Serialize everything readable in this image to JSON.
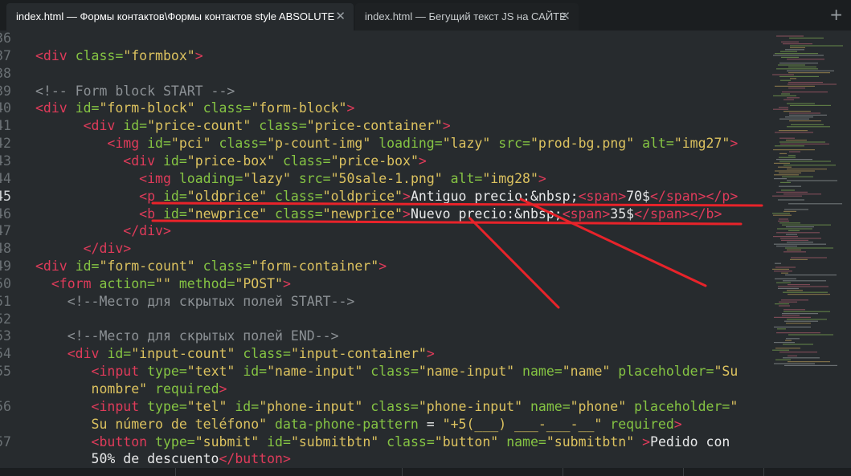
{
  "tabs": [
    {
      "label": "index.html — Формы контактов\\Формы контактов style ABSOLUTE",
      "active": true
    },
    {
      "label": "index.html — Бегущий текст JS на САЙТЕ",
      "active": false
    }
  ],
  "close_glyph": "✕",
  "new_tab_glyph": "+",
  "active_line": "45",
  "colors": {
    "tag": "#df3b5a",
    "attribute": "#85c443",
    "string": "#dcc25f",
    "text": "#e7e8e9",
    "comment": "#8c9195",
    "annotation": "#e8232a",
    "background": "#272b2e"
  },
  "lines": [
    {
      "n": "36",
      "tokens": []
    },
    {
      "n": "37",
      "tokens": [
        [
          "tag",
          "<div"
        ],
        [
          "txt",
          " "
        ],
        [
          "attr",
          "class="
        ],
        [
          "val",
          "\"formbox\""
        ],
        [
          "tag",
          ">"
        ]
      ]
    },
    {
      "n": "38",
      "tokens": []
    },
    {
      "n": "39",
      "tokens": [
        [
          "com",
          "<!-- Form block START -->"
        ]
      ]
    },
    {
      "n": "40",
      "tokens": [
        [
          "tag",
          "<div"
        ],
        [
          "txt",
          " "
        ],
        [
          "attr",
          "id="
        ],
        [
          "val",
          "\"form-block\""
        ],
        [
          "txt",
          " "
        ],
        [
          "attr",
          "class="
        ],
        [
          "val",
          "\"form-block\""
        ],
        [
          "tag",
          ">"
        ]
      ]
    },
    {
      "n": "41",
      "tokens": [
        [
          "txt",
          "      "
        ],
        [
          "tag",
          "<div"
        ],
        [
          "txt",
          " "
        ],
        [
          "attr",
          "id="
        ],
        [
          "val",
          "\"price-count\""
        ],
        [
          "txt",
          " "
        ],
        [
          "attr",
          "class="
        ],
        [
          "val",
          "\"price-container\""
        ],
        [
          "tag",
          ">"
        ]
      ]
    },
    {
      "n": "42",
      "tokens": [
        [
          "txt",
          "         "
        ],
        [
          "tag",
          "<img"
        ],
        [
          "txt",
          " "
        ],
        [
          "attr",
          "id="
        ],
        [
          "val",
          "\"pci\""
        ],
        [
          "txt",
          " "
        ],
        [
          "attr",
          "class="
        ],
        [
          "val",
          "\"p-count-img\""
        ],
        [
          "txt",
          " "
        ],
        [
          "attr",
          "loading="
        ],
        [
          "val",
          "\"lazy\""
        ],
        [
          "txt",
          " "
        ],
        [
          "attr",
          "src="
        ],
        [
          "val",
          "\"prod-bg.png\""
        ],
        [
          "txt",
          " "
        ],
        [
          "attr",
          "alt="
        ],
        [
          "val",
          "\"img27\""
        ],
        [
          "tag",
          ">"
        ]
      ]
    },
    {
      "n": "43",
      "tokens": [
        [
          "txt",
          "           "
        ],
        [
          "tag",
          "<div"
        ],
        [
          "txt",
          " "
        ],
        [
          "attr",
          "id="
        ],
        [
          "val",
          "\"price-box\""
        ],
        [
          "txt",
          " "
        ],
        [
          "attr",
          "class="
        ],
        [
          "val",
          "\"price-box\""
        ],
        [
          "tag",
          ">"
        ]
      ]
    },
    {
      "n": "44",
      "tokens": [
        [
          "txt",
          "             "
        ],
        [
          "tag",
          "<img"
        ],
        [
          "txt",
          " "
        ],
        [
          "attr",
          "loading="
        ],
        [
          "val",
          "\"lazy\""
        ],
        [
          "txt",
          " "
        ],
        [
          "attr",
          "src="
        ],
        [
          "val",
          "\"50sale-1.png\""
        ],
        [
          "txt",
          " "
        ],
        [
          "attr",
          "alt="
        ],
        [
          "val",
          "\"img28\""
        ],
        [
          "tag",
          ">"
        ]
      ]
    },
    {
      "n": "45",
      "tokens": [
        [
          "txt",
          "             "
        ],
        [
          "tag",
          "<p"
        ],
        [
          "txt",
          " "
        ],
        [
          "attr",
          "id="
        ],
        [
          "val",
          "\"oldprice\""
        ],
        [
          "txt",
          " "
        ],
        [
          "attr",
          "class="
        ],
        [
          "val",
          "\"oldprice\""
        ],
        [
          "tag",
          ">"
        ],
        [
          "txt",
          "Antiguo precio:&nbsp;"
        ],
        [
          "tag",
          "<span>"
        ],
        [
          "txt",
          "70$"
        ],
        [
          "tag",
          "</span></p>"
        ]
      ]
    },
    {
      "n": "46",
      "tokens": [
        [
          "txt",
          "             "
        ],
        [
          "tag",
          "<b"
        ],
        [
          "txt",
          " "
        ],
        [
          "attr",
          "id="
        ],
        [
          "val",
          "\"newprice\""
        ],
        [
          "txt",
          " "
        ],
        [
          "attr",
          "class="
        ],
        [
          "val",
          "\"newprice\""
        ],
        [
          "tag",
          ">"
        ],
        [
          "txt",
          "Nuevo precio:&nbsp;"
        ],
        [
          "tag",
          "<span>"
        ],
        [
          "txt",
          "35$"
        ],
        [
          "tag",
          "</span></b>"
        ]
      ]
    },
    {
      "n": "47",
      "tokens": [
        [
          "txt",
          "           "
        ],
        [
          "tag",
          "</div>"
        ]
      ]
    },
    {
      "n": "48",
      "tokens": [
        [
          "txt",
          "      "
        ],
        [
          "tag",
          "</div>"
        ]
      ]
    },
    {
      "n": "49",
      "tokens": [
        [
          "tag",
          "<div"
        ],
        [
          "txt",
          " "
        ],
        [
          "attr",
          "id="
        ],
        [
          "val",
          "\"form-count\""
        ],
        [
          "txt",
          " "
        ],
        [
          "attr",
          "class="
        ],
        [
          "val",
          "\"form-container\""
        ],
        [
          "tag",
          ">"
        ]
      ]
    },
    {
      "n": "50",
      "tokens": [
        [
          "txt",
          "  "
        ],
        [
          "tag",
          "<form"
        ],
        [
          "txt",
          " "
        ],
        [
          "attr",
          "action="
        ],
        [
          "val",
          "\"\""
        ],
        [
          "txt",
          " "
        ],
        [
          "attr",
          "method="
        ],
        [
          "val",
          "\"POST\""
        ],
        [
          "tag",
          ">"
        ]
      ]
    },
    {
      "n": "51",
      "tokens": [
        [
          "txt",
          "    "
        ],
        [
          "com",
          "<!--Место для скрытых полей START-->"
        ]
      ]
    },
    {
      "n": "52",
      "tokens": []
    },
    {
      "n": "53",
      "tokens": [
        [
          "txt",
          "    "
        ],
        [
          "com",
          "<!--Место для скрытых полей END-->"
        ]
      ]
    },
    {
      "n": "54",
      "tokens": [
        [
          "txt",
          "    "
        ],
        [
          "tag",
          "<div"
        ],
        [
          "txt",
          " "
        ],
        [
          "attr",
          "id="
        ],
        [
          "val",
          "\"input-count\""
        ],
        [
          "txt",
          " "
        ],
        [
          "attr",
          "class="
        ],
        [
          "val",
          "\"input-container\""
        ],
        [
          "tag",
          ">"
        ]
      ]
    },
    {
      "n": "55",
      "tokens": [
        [
          "txt",
          "       "
        ],
        [
          "tag",
          "<input"
        ],
        [
          "txt",
          " "
        ],
        [
          "attr",
          "type="
        ],
        [
          "val",
          "\"text\""
        ],
        [
          "txt",
          " "
        ],
        [
          "attr",
          "id="
        ],
        [
          "val",
          "\"name-input\""
        ],
        [
          "txt",
          " "
        ],
        [
          "attr",
          "class="
        ],
        [
          "val",
          "\"name-input\""
        ],
        [
          "txt",
          " "
        ],
        [
          "attr",
          "name="
        ],
        [
          "val",
          "\"name\""
        ],
        [
          "txt",
          " "
        ],
        [
          "attr",
          "placeholder="
        ],
        [
          "val",
          "\"Su"
        ]
      ]
    },
    {
      "n": "",
      "tokens": [
        [
          "txt",
          "       "
        ],
        [
          "val",
          "nombre\""
        ],
        [
          "txt",
          " "
        ],
        [
          "attr",
          "required"
        ],
        [
          "tag",
          ">"
        ]
      ]
    },
    {
      "n": "56",
      "tokens": [
        [
          "txt",
          "       "
        ],
        [
          "tag",
          "<input"
        ],
        [
          "txt",
          " "
        ],
        [
          "attr",
          "type="
        ],
        [
          "val",
          "\"tel\""
        ],
        [
          "txt",
          " "
        ],
        [
          "attr",
          "id="
        ],
        [
          "val",
          "\"phone-input\""
        ],
        [
          "txt",
          " "
        ],
        [
          "attr",
          "class="
        ],
        [
          "val",
          "\"phone-input\""
        ],
        [
          "txt",
          " "
        ],
        [
          "attr",
          "name="
        ],
        [
          "val",
          "\"phone\""
        ],
        [
          "txt",
          " "
        ],
        [
          "attr",
          "placeholder="
        ],
        [
          "val",
          "\""
        ]
      ]
    },
    {
      "n": "",
      "tokens": [
        [
          "txt",
          "       "
        ],
        [
          "val",
          "Su número de teléfono\""
        ],
        [
          "txt",
          " "
        ],
        [
          "attr",
          "data-phone-pattern"
        ],
        [
          "txt",
          " = "
        ],
        [
          "val",
          "\"+5(___) ___-___-__\""
        ],
        [
          "txt",
          " "
        ],
        [
          "attr",
          "required"
        ],
        [
          "tag",
          ">"
        ]
      ]
    },
    {
      "n": "57",
      "tokens": [
        [
          "txt",
          "       "
        ],
        [
          "tag",
          "<button"
        ],
        [
          "txt",
          " "
        ],
        [
          "attr",
          "type="
        ],
        [
          "val",
          "\"submit\""
        ],
        [
          "txt",
          " "
        ],
        [
          "attr",
          "id="
        ],
        [
          "val",
          "\"submitbtn\""
        ],
        [
          "txt",
          " "
        ],
        [
          "attr",
          "class="
        ],
        [
          "val",
          "\"button\""
        ],
        [
          "txt",
          " "
        ],
        [
          "attr",
          "name="
        ],
        [
          "val",
          "\"submitbtn\""
        ],
        [
          "txt",
          " "
        ],
        [
          "tag",
          ">"
        ],
        [
          "txt",
          "Pedido con"
        ]
      ]
    },
    {
      "n": "",
      "tokens": [
        [
          "txt",
          "       "
        ],
        [
          "txt",
          "50% de descuento"
        ],
        [
          "tag",
          "</button>"
        ]
      ]
    }
  ]
}
